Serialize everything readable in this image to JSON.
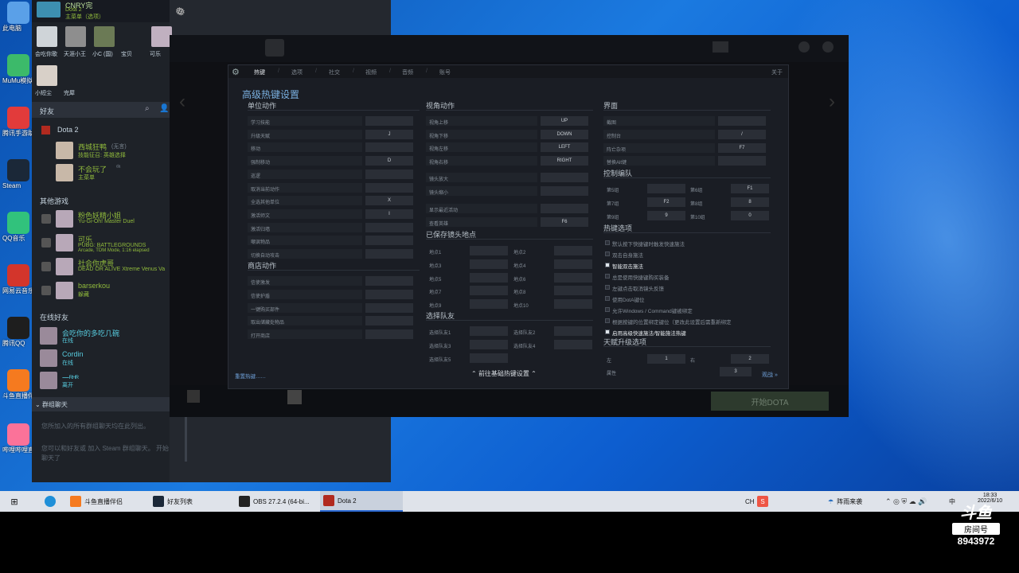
{
  "desktop": {
    "icons": [
      {
        "label": "此电脑",
        "icon": "computer-icon",
        "color": "#5aa0e8"
      },
      {
        "label": "MuMu模拟器",
        "icon": "mumu-icon",
        "color": "#3cba6a"
      },
      {
        "label": "腾讯手游助手",
        "icon": "tencent-games-icon",
        "color": "#e23b3b"
      },
      {
        "label": "Steam",
        "icon": "steam-icon",
        "color": "#1b2838"
      },
      {
        "label": "QQ音乐",
        "icon": "qq-music-icon",
        "color": "#31c27c"
      },
      {
        "label": "网易云音乐",
        "icon": "netease-music-icon",
        "color": "#d3352b"
      },
      {
        "label": "腾讯QQ",
        "icon": "qq-icon",
        "color": "#1e1e1e"
      },
      {
        "label": "斗鱼直播伴侣",
        "icon": "douyu-icon",
        "color": "#f57a1f"
      },
      {
        "label": "哔哩哔哩直播工具",
        "icon": "bilibili-icon",
        "color": "#fb7299"
      }
    ]
  },
  "friends": {
    "user": {
      "name": "CNRY完",
      "game": "Dota 2",
      "status": "主菜单（选项）"
    },
    "top_avatars": [
      "会吃你歌",
      "天涯小王",
      "小C (国)",
      "宝贝",
      "可乐"
    ],
    "top_avatars2": [
      "小短尘",
      "完犀"
    ],
    "search_label": "好友",
    "dota_header": "Dota 2",
    "dota_friends": [
      {
        "name": "西城狂鸭",
        "tag": "(无言)",
        "status": "技能征召: 英雄选择"
      },
      {
        "name": "不会玩了",
        "tag": "ᵈᵃ",
        "status": "主菜单"
      }
    ],
    "other_header": "其他游戏",
    "other_friends": [
      {
        "name": "粉色妖精小姐",
        "status": "Yu-Gi-Oh! Master Duel"
      },
      {
        "name": "可乐",
        "status": "PUBG: BATTLEGROUNDS",
        "status2": "Arcade, TDM Mode, 1:16 elapsed"
      },
      {
        "name": "社会你虎哥",
        "status": "DEAD OR ALIVE Xtreme Venus Va"
      },
      {
        "name": "barserkou",
        "status": "躲藏"
      }
    ],
    "online_header": "在线好友",
    "online_friends": [
      {
        "name": "会吃你的多吃几碗",
        "status": "在线"
      },
      {
        "name": "Cordin",
        "status": "在线"
      },
      {
        "name": "一ᴿᴴᴿ",
        "status": "离开"
      }
    ],
    "group_header": "群组聊天",
    "group_text1": "您所加入的所有群组聊天均在此列出。",
    "group_text2": "您可以和好友或 加入 Steam 群组聊天。 开始聊天了"
  },
  "dota": {
    "play_button": "开始DOTA",
    "dialog": {
      "tabs": [
        "热键",
        "选项",
        "社交",
        "视频",
        "音频",
        "账号"
      ],
      "about": "关于",
      "title": "高级热键设置",
      "unit_header": "单位动作",
      "unit_rows": [
        {
          "label": "学习技能",
          "key": ""
        },
        {
          "label": "升级天赋",
          "key": "J"
        },
        {
          "label": "移动",
          "key": ""
        },
        {
          "label": "强制移动",
          "key": "D"
        },
        {
          "label": "巡逻",
          "key": ""
        },
        {
          "label": "取消当前动作",
          "key": ""
        },
        {
          "label": "全选其他单位",
          "key": "X"
        },
        {
          "label": "激活师文",
          "key": "I"
        },
        {
          "label": "激活归墙",
          "key": ""
        },
        {
          "label": "嘲讽物品",
          "key": ""
        },
        {
          "label": "切换自动攻击",
          "key": ""
        }
      ],
      "shop_header": "商店动作",
      "shop_rows": [
        {
          "label": "信使激发",
          "key": ""
        },
        {
          "label": "信使护盾",
          "key": ""
        },
        {
          "label": "一键购买部件",
          "key": ""
        },
        {
          "label": "取出储藏处物品",
          "key": ""
        },
        {
          "label": "打开商店",
          "key": ""
        }
      ],
      "reset_link": "重置热键……",
      "camera_header": "视角动作",
      "camera_rows": [
        {
          "label": "视角上移",
          "key": "UP"
        },
        {
          "label": "视角下移",
          "key": "DOWN"
        },
        {
          "label": "视角左移",
          "key": "LEFT"
        },
        {
          "label": "视角右移",
          "key": "RIGHT"
        },
        {
          "label": "镜头放大",
          "key": ""
        },
        {
          "label": "镜头缩小",
          "key": ""
        },
        {
          "label": "显示最近活动",
          "key": ""
        },
        {
          "label": "查看英雄",
          "key": "F6"
        }
      ],
      "saved_header": "已保存镜头地点",
      "saved_left": [
        "地点1",
        "地点3",
        "地点5",
        "地点7",
        "地点9"
      ],
      "saved_right": [
        "地点2",
        "地点4",
        "地点6",
        "地点8",
        "地点10"
      ],
      "select_header": "选择队友",
      "select_left": [
        "选择队友1",
        "选择队友3",
        "选择队友5"
      ],
      "select_right": [
        "选择队友2",
        "选择队友4"
      ],
      "basic_link": "前往基础热键设置",
      "ui_header": "界面",
      "ui_rows": [
        {
          "label": "截图",
          "key": ""
        },
        {
          "label": "控制台",
          "key": "/"
        },
        {
          "label": "阵亡杂项",
          "key": "F7"
        },
        {
          "label": "替换Alt键",
          "key": ""
        }
      ],
      "group_header": "控制编队",
      "groups": [
        {
          "left": "第5组",
          "lkey": "",
          "right": "第6组",
          "rkey": "F1"
        },
        {
          "left": "第7组",
          "lkey": "F2",
          "right": "第8组",
          "rkey": "8"
        },
        {
          "left": "第9组",
          "lkey": "9",
          "right": "第10组",
          "rkey": "0"
        }
      ],
      "hk_header": "热键选项",
      "hk_options": [
        {
          "label": "默认按下快捷键时触发快速施法",
          "checked": false
        },
        {
          "label": "双击自身施法",
          "checked": false
        },
        {
          "label": "智能双击施法",
          "checked": true
        },
        {
          "label": "总是使用快捷键购买装备",
          "checked": false
        },
        {
          "label": "左键点击取消镜头反馈",
          "checked": false
        },
        {
          "label": "使用DotA键位",
          "checked": false
        },
        {
          "label": "允许Windows / Command键被绑定",
          "checked": false
        },
        {
          "label": "根据按键的位置绑定键位（更改此设置后需重新绑定",
          "checked": false
        },
        {
          "label": "启用高级快速施法/智能施法热键",
          "checked": true
        }
      ],
      "talent_header": "天赋升级选项",
      "talent_rows": [
        {
          "left": "左",
          "lkey": "1",
          "right": "右",
          "rkey": "2"
        }
      ],
      "talent_attr": "属性",
      "talent_attr_key": "3",
      "close_link": "观战 »"
    }
  },
  "taskbar": {
    "items": [
      {
        "label": "斗鱼直播伴侣",
        "icon": "douyu-icon",
        "color": "#f57a1f"
      },
      {
        "label": "好友列表",
        "icon": "steam-icon",
        "color": "#1b2838"
      },
      {
        "label": "OBS 27.2.4 (64-bi...",
        "icon": "obs-icon",
        "color": "#222"
      },
      {
        "label": "Dota 2",
        "icon": "dota-icon",
        "color": "#b12a1f"
      }
    ],
    "weather": "阵雨来袭",
    "ime": "CH",
    "lang": "中",
    "time": "18:33",
    "date": "2022/6/10"
  },
  "watermark": {
    "top": "斗鱼",
    "mid": "房间号",
    "room": "8943972"
  }
}
